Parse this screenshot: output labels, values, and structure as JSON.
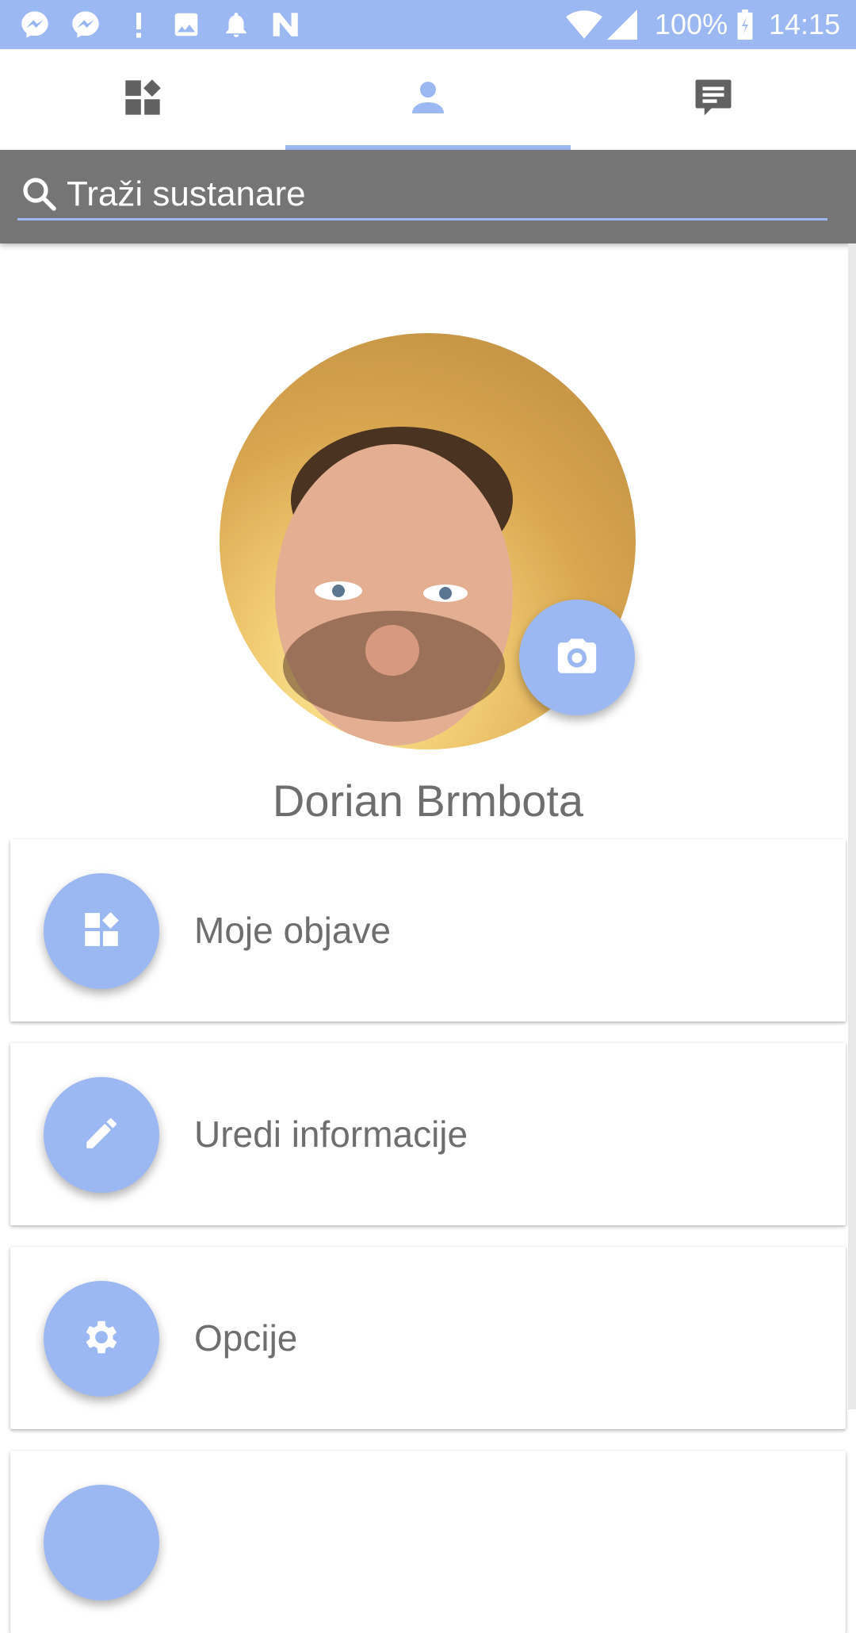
{
  "status_bar": {
    "battery": "100%",
    "time": "14:15",
    "icons": [
      "messenger-icon",
      "messenger-icon",
      "exclamation-icon",
      "image-icon",
      "bell-icon",
      "n-icon",
      "wifi-icon",
      "signal-icon",
      "battery-icon"
    ]
  },
  "tabs": [
    {
      "icon": "dashboard-icon",
      "selected": false
    },
    {
      "icon": "person-icon",
      "selected": true
    },
    {
      "icon": "message-icon",
      "selected": false
    }
  ],
  "search": {
    "placeholder": "Traži sustanare",
    "value": ""
  },
  "profile": {
    "name": "Dorian Brmbota"
  },
  "menu": [
    {
      "label": "Moje objave",
      "icon": "dashboard-icon"
    },
    {
      "label": "Uredi informacije",
      "icon": "pencil-icon"
    },
    {
      "label": "Opcije",
      "icon": "gear-icon"
    },
    {
      "label": "",
      "icon": ""
    }
  ],
  "colors": {
    "accent": "#9bb8f3",
    "search_bg": "#757575",
    "text_gray": "#6e6e6e"
  }
}
